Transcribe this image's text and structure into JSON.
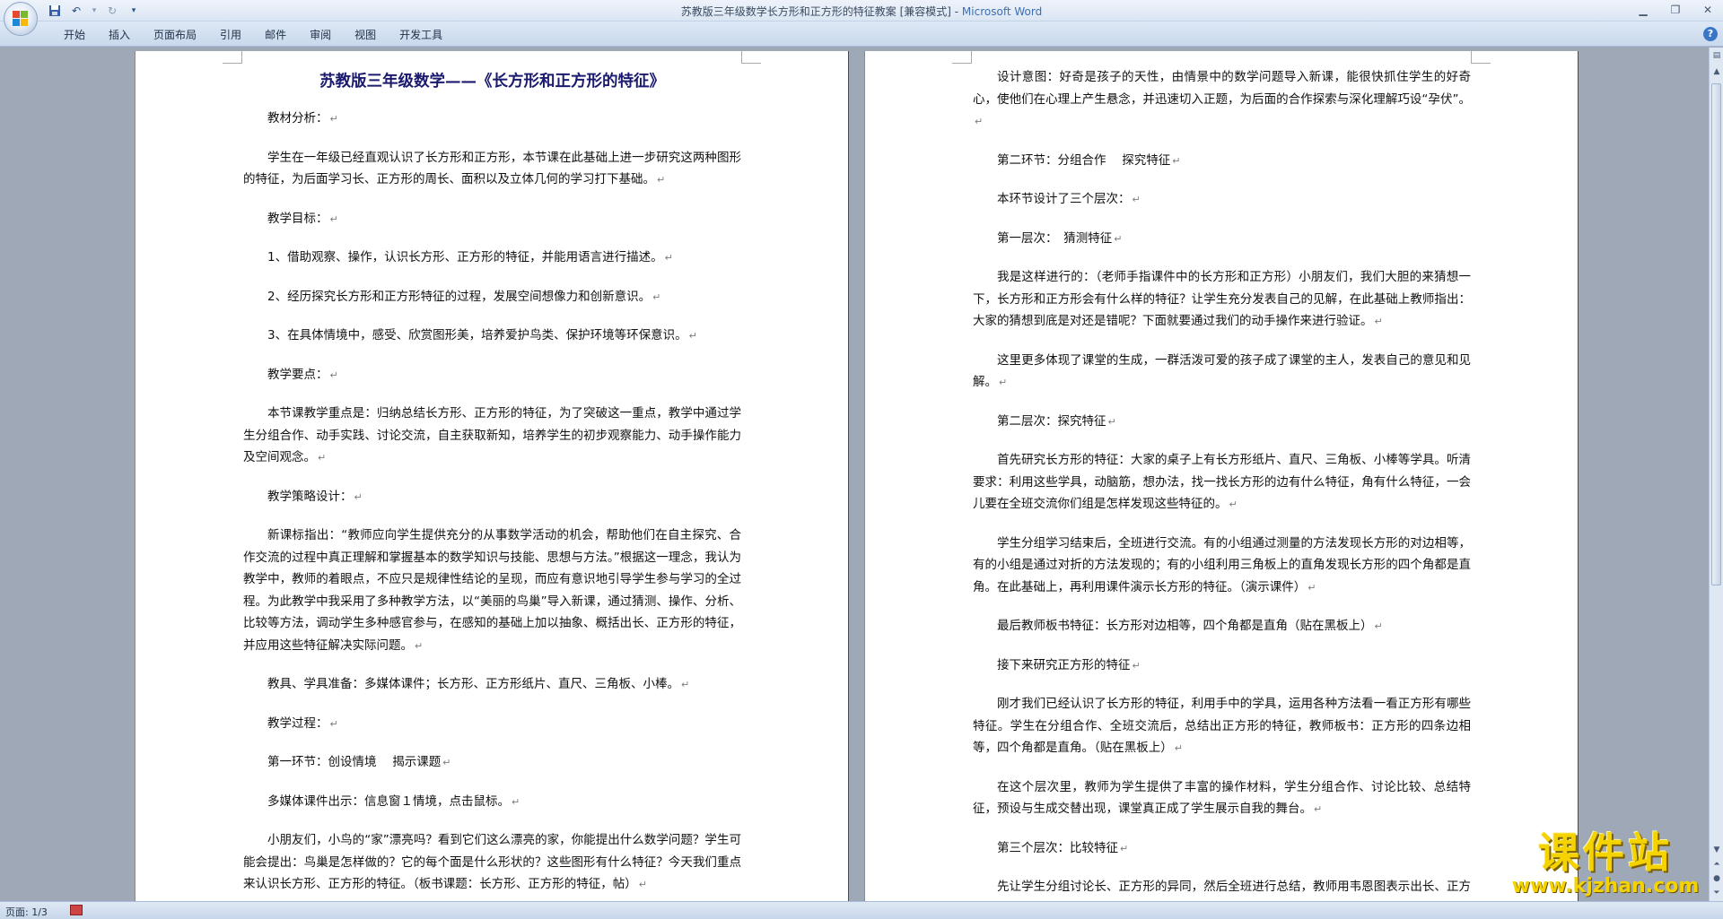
{
  "window": {
    "title_doc": "苏教版三年级数学长方形和正方形的特征教案 [兼容模式] - ",
    "title_app": "Microsoft Word"
  },
  "ribbon": {
    "tabs": [
      "开始",
      "插入",
      "页面布局",
      "引用",
      "邮件",
      "审阅",
      "视图",
      "开发工具"
    ]
  },
  "status": {
    "page": "页面: 1/3"
  },
  "left_page": {
    "title": "苏教版三年级数学——《长方形和正方形的特征》",
    "paragraphs": [
      "教材分析：",
      "学生在一年级已经直观认识了长方形和正方形，本节课在此基础上进一步研究这两种图形的特征，为后面学习长、正方形的周长、面积以及立体几何的学习打下基础。",
      "教学目标：",
      "1、借助观察、操作，认识长方形、正方形的特征，并能用语言进行描述。",
      "2、经历探究长方形和正方形特征的过程，发展空间想像力和创新意识。",
      "3、在具体情境中，感受、欣赏图形美，培养爱护鸟类、保护环境等环保意识。",
      "教学要点：",
      "本节课教学重点是：归纳总结长方形、正方形的特征，为了突破这一重点，教学中通过学生分组合作、动手实践、讨论交流，自主获取新知，培养学生的初步观察能力、动手操作能力及空间观念。",
      "教学策略设计：",
      "新课标指出：“教师应向学生提供充分的从事数学活动的机会，帮助他们在自主探究、合作交流的过程中真正理解和掌握基本的数学知识与技能、思想与方法。”根据这一理念，我认为教学中，教师的着眼点，不应只是规律性结论的呈现，而应有意识地引导学生参与学习的全过程。为此教学中我采用了多种教学方法，以“美丽的鸟巢”导入新课，通过猜测、操作、分析、比较等方法，调动学生多种感官参与，在感知的基础上加以抽象、概括出长、正方形的特征，并应用这些特征解决实际问题。",
      "教具、学具准备：多媒体课件；长方形、正方形纸片、直尺、三角板、小棒。",
      "教学过程：",
      "第一环节：创设情境　 揭示课题",
      "多媒体课件出示：信息窗１情境，点击鼠标。",
      "小朋友们，小鸟的“家”漂亮吗？看到它们这么漂亮的家，你能提出什么数学问题？学生可能会提出：鸟巢是怎样做的？它的每个面是什么形状的？这些图形有什么特征？今天我们重点来认识长方形、正方形的特征。（板书课题：长方形、正方形的特征，帖）"
    ]
  },
  "right_page": {
    "paragraphs": [
      "设计意图：好奇是孩子的天性，由情景中的数学问题导入新课，能很快抓住学生的好奇心，使他们在心理上产生悬念，并迅速切入正题，为后面的合作探索与深化理解巧设“孕伏”。",
      "第二环节：分组合作　 探究特征",
      "本环节设计了三个层次：",
      "第一层次：　猜测特征",
      "我是这样进行的：（老师手指课件中的长方形和正方形）小朋友们，我们大胆的来猜想一下，长方形和正方形会有什么样的特征？让学生充分发表自己的见解，在此基础上教师指出：大家的猜想到底是对还是错呢？下面就要通过我们的动手操作来进行验证。",
      "这里更多体现了课堂的生成，一群活泼可爱的孩子成了课堂的主人，发表自己的意见和见解。",
      "第二层次：探究特征",
      "首先研究长方形的特征：大家的桌子上有长方形纸片、直尺、三角板、小棒等学具。听清要求：利用这些学具，动脑筋，想办法，找一找长方形的边有什么特征，角有什么特征，一会儿要在全班交流你们组是怎样发现这些特征的。",
      "学生分组学习结束后，全班进行交流。有的小组通过测量的方法发现长方形的对边相等，有的小组是通过对折的方法发现的；有的小组利用三角板上的直角发现长方形的四个角都是直角。在此基础上，再利用课件演示长方形的特征。（演示课件）",
      "最后教师板书特征：长方形对边相等，四个角都是直角（贴在黑板上）",
      "接下来研究正方形的特征",
      "刚才我们已经认识了长方形的特征，利用手中的学具，运用各种方法看一看正方形有哪些特征。学生在分组合作、全班交流后，总结出正方形的特征，教师板书：正方形的四条边相等，四个角都是直角。（贴在黑板上）",
      "在这个层次里，教师为学生提供了丰富的操作材料，学生分组合作、讨论比较、总结特征，预设与生成交替出现，课堂真正成了学生展示自我的舞台。",
      "第三个层次：比较特征",
      "先让学生分组讨论长、正方形的异同，然后全班进行总结，教师用韦恩图表示出长、正方形的关系。（画图）"
    ]
  },
  "watermark": {
    "brand": "课件站",
    "url": "www.kjzhan.com"
  },
  "colors": {
    "title_color": "#1a1a6e",
    "ribbon_bg": "#c9d8ec",
    "workspace_bg": "#9ea8b6",
    "watermark": "#f4d300"
  }
}
